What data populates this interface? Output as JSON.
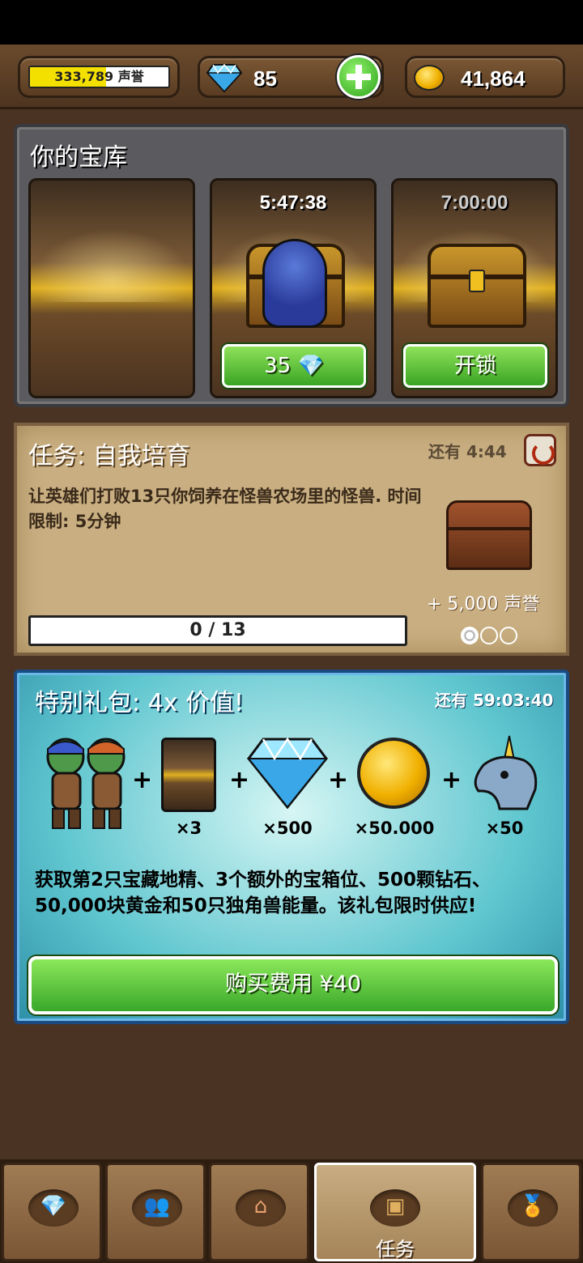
{
  "header": {
    "reputation": "333,789 声誉",
    "reputation_fill": 0.55,
    "gems": "85",
    "gold": "41,864"
  },
  "vault": {
    "title": "你的宝库",
    "slots": [
      {
        "timer": ""
      },
      {
        "timer": "5:47:38",
        "button": "35 💎"
      },
      {
        "timer": "7:00:00",
        "button": "开锁"
      }
    ]
  },
  "quest": {
    "title": "任务: 自我培育",
    "time_left": "还有 4:44",
    "description": "让英雄们打败13只你饲养在怪兽农场里的怪兽. 时间限制: 5分钟",
    "progress": "0 / 13",
    "progress_value": 0,
    "reward": "+ 5,000 声誉"
  },
  "offer": {
    "title": "特别礼包: 4x 价值!",
    "time_left": "还有 59:03:40",
    "items": [
      {
        "qty": "×3"
      },
      {
        "qty": "×500"
      },
      {
        "qty": "×50.000"
      },
      {
        "qty": "×50"
      }
    ],
    "description": "获取第2只宝藏地精、3个额外的宝箱位、500颗钻石、50,000块黄金和50只独角兽能量。该礼包限时供应!",
    "buy_label": "购买费用 ¥40"
  },
  "nav": {
    "active_label": "任务"
  },
  "colors": {
    "accent_green": "#3aa524",
    "rep_bar": "#f4e000"
  }
}
